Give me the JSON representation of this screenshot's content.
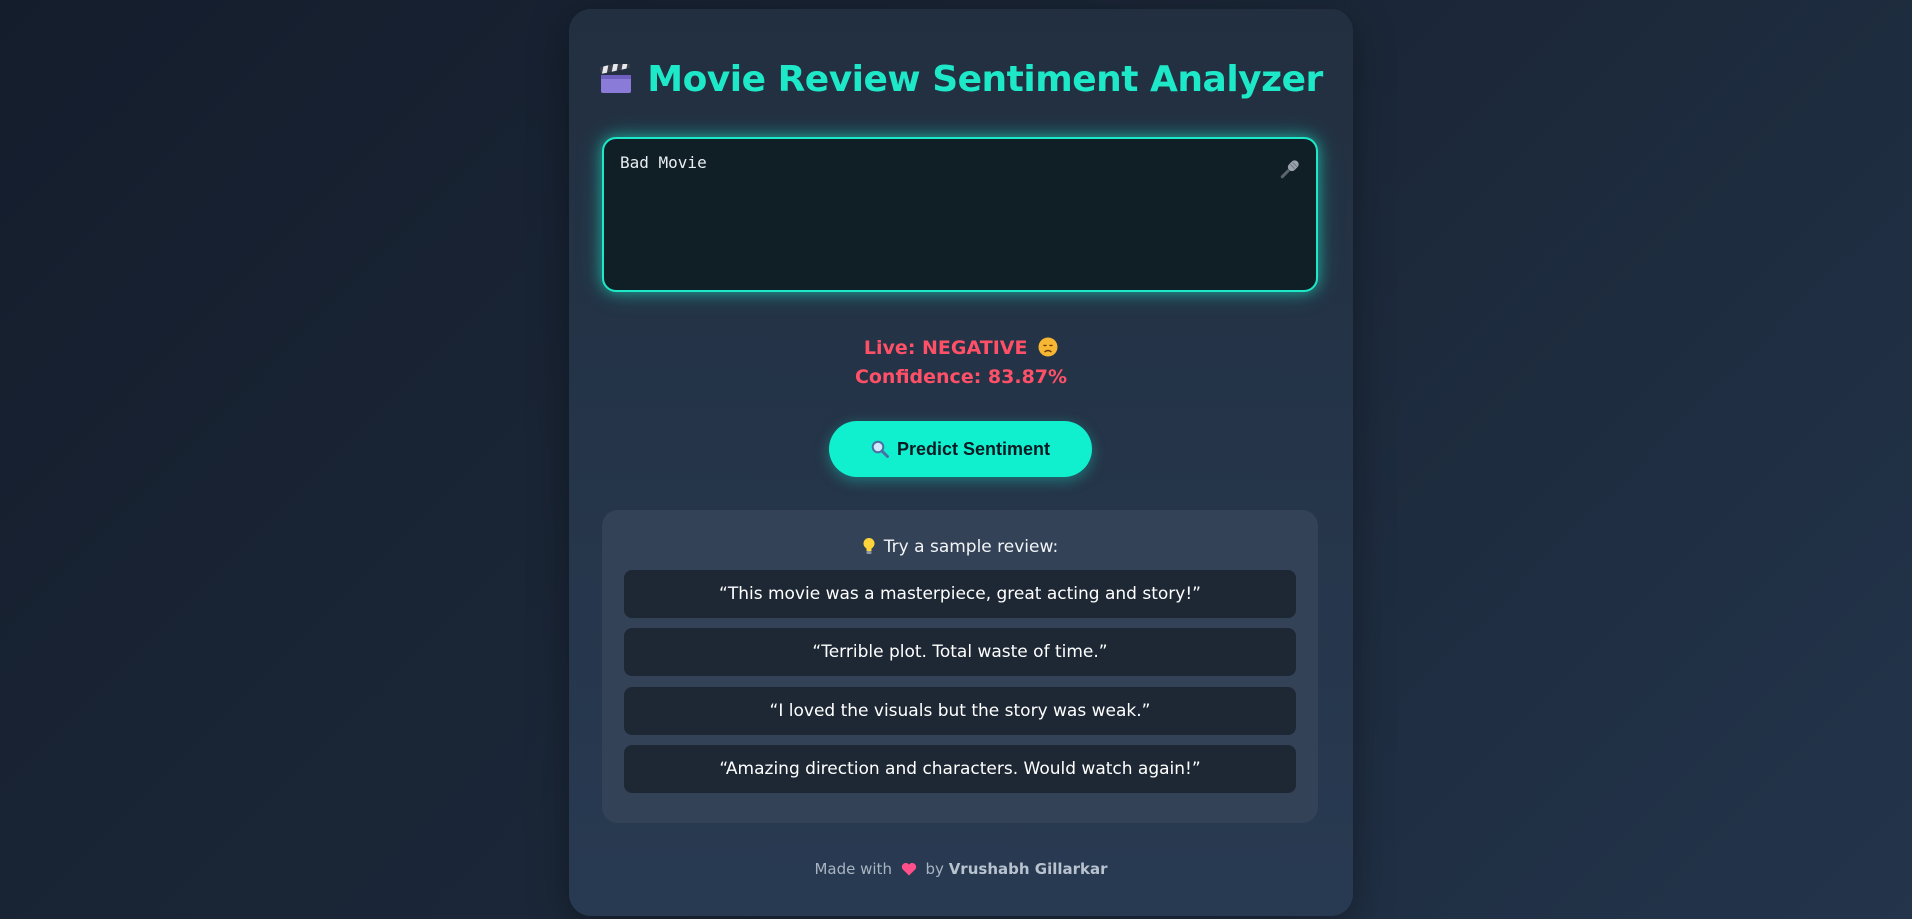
{
  "app": {
    "title": "Movie Review Sentiment Analyzer",
    "title_icon": "clapperboard-icon",
    "accent_color": "#1de9c9"
  },
  "review_input": {
    "value": "Bad Movie",
    "mic_icon": "microphone-icon"
  },
  "live_result": {
    "live_text": "Live: NEGATIVE",
    "live_icon": "sad-face-icon",
    "confidence_text": "Confidence: 83.87%",
    "color": "#ff5068"
  },
  "predict_button": {
    "label": "Predict Sentiment",
    "icon": "magnifier-icon"
  },
  "samples": {
    "title": "Try a sample review:",
    "title_icon": "lightbulb-icon",
    "items": [
      "“This movie was a masterpiece, great acting and story!”",
      "“Terrible plot. Total waste of time.”",
      "“I loved the visuals but the story was weak.”",
      "“Amazing direction and characters. Would watch again!”"
    ]
  },
  "footer": {
    "prefix": "Made with",
    "heart_icon": "heart-icon",
    "by": "by",
    "author": "Vrushabh Gillarkar"
  }
}
